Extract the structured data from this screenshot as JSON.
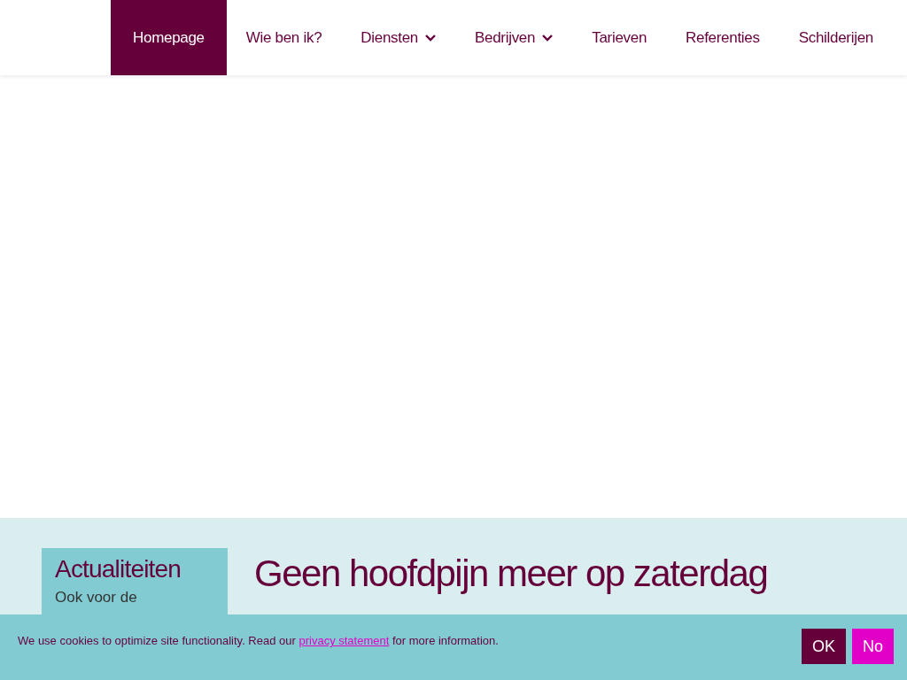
{
  "nav": {
    "items": [
      {
        "label": "Homepage",
        "selected": true,
        "dropdown": false
      },
      {
        "label": "Wie ben ik?",
        "selected": false,
        "dropdown": false
      },
      {
        "label": "Diensten",
        "selected": false,
        "dropdown": true
      },
      {
        "label": "Bedrijven",
        "selected": false,
        "dropdown": true
      },
      {
        "label": "Tarieven",
        "selected": false,
        "dropdown": false
      },
      {
        "label": "Referenties",
        "selected": false,
        "dropdown": false
      },
      {
        "label": "Schilderijen",
        "selected": false,
        "dropdown": false
      }
    ]
  },
  "sidebar": {
    "title": "Actualiteiten",
    "text": "Ook voor de"
  },
  "article": {
    "heading": "Geen hoofdpijn meer op zaterdag"
  },
  "cookie_bar": {
    "text_before": "We use cookies to optimize site functionality. Read our",
    "link": "privacy statement",
    "text_after": "for more information.",
    "buttons": [
      {
        "label": "OK",
        "kind": "accept"
      },
      {
        "label": "No",
        "kind": "decline"
      }
    ]
  }
}
